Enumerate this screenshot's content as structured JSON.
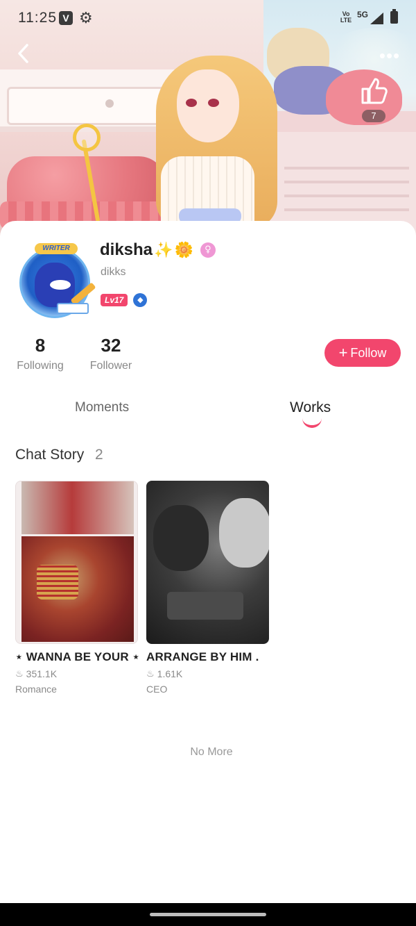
{
  "status_bar": {
    "time": "11:25",
    "app_icon": "V",
    "settings_icon": "gear-icon",
    "network_volte": "Vo LTE",
    "network_type": "5G",
    "signal_icon": "signal-icon",
    "battery_icon": "battery-icon"
  },
  "header": {
    "back_icon": "chevron-left-icon",
    "more_label": "•••",
    "like_icon": "thumbs-up-icon",
    "like_count": "7"
  },
  "profile": {
    "username": "diksha",
    "name_emojis": [
      "✨",
      "🌼"
    ],
    "gender_icon": "female-icon",
    "handle": "dikks",
    "level_badge": "Lv17",
    "avatar_badge": "WRITER",
    "verified_icon": "gem-icon"
  },
  "stats": {
    "following": {
      "value": "8",
      "label": "Following"
    },
    "follower": {
      "value": "32",
      "label": "Follower"
    }
  },
  "follow_button": {
    "label": "Follow",
    "icon": "plus-icon"
  },
  "tabs": [
    {
      "label": "Moments",
      "active": false
    },
    {
      "label": "Works",
      "active": true
    }
  ],
  "section": {
    "title": "Chat Story",
    "count": "2"
  },
  "stories": [
    {
      "title": "⋆ WANNA BE YOUR ⋆",
      "views": "351.1K",
      "genre": "Romance"
    },
    {
      "title": "ARRANGE BY HIM .",
      "views": "1.61K",
      "genre": "CEO"
    }
  ],
  "footer": {
    "no_more": "No More"
  },
  "colors": {
    "accent": "#f2466d",
    "text_primary": "#222222",
    "text_secondary": "#8a8a8a"
  }
}
